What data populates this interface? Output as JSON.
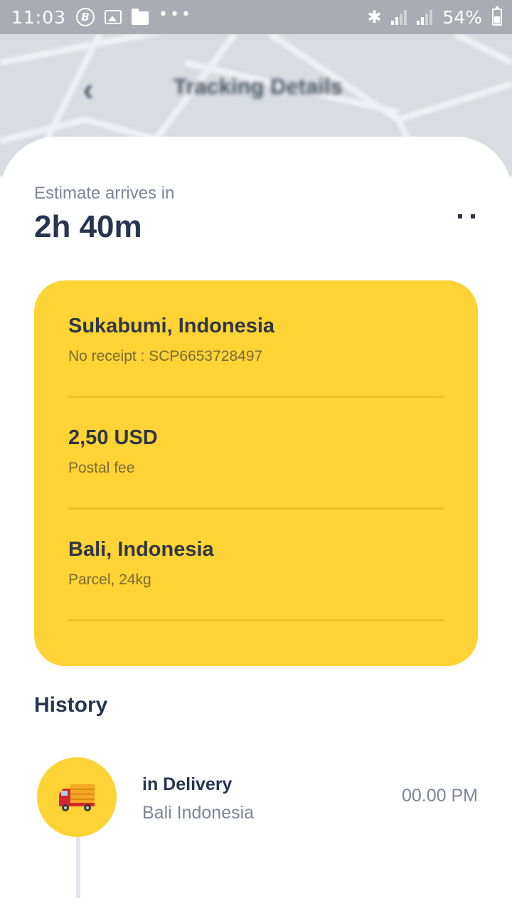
{
  "status_bar": {
    "time": "11:03",
    "battery_percent": "54%",
    "notification_icons": [
      "bitcoin-icon",
      "gallery-icon",
      "folder-icon",
      "more-dots-icon"
    ],
    "system_icons": [
      "bluetooth-icon",
      "signal-icon",
      "signal-icon",
      "battery-icon"
    ]
  },
  "header": {
    "title": "Tracking Details",
    "back_icon": "chevron-left-icon"
  },
  "eta": {
    "label": "Estimate arrives in",
    "value": "2h 40m"
  },
  "info_card": {
    "color": "#fdd335",
    "rows": [
      {
        "primary": "Sukabumi, Indonesia",
        "secondary": "No receipt : SCP6653728497"
      },
      {
        "primary": "2,50 USD",
        "secondary": "Postal fee"
      },
      {
        "primary": "Bali, Indonesia",
        "secondary": "Parcel, 24kg"
      }
    ]
  },
  "history": {
    "title": "History",
    "items": [
      {
        "icon": "delivery-truck-icon",
        "status": "in Delivery",
        "location": "Bali Indonesia",
        "time": "00.00 PM"
      }
    ]
  },
  "colors": {
    "accent_yellow": "#fdd335",
    "text_dark": "#27354f",
    "text_muted": "#7d8596"
  }
}
